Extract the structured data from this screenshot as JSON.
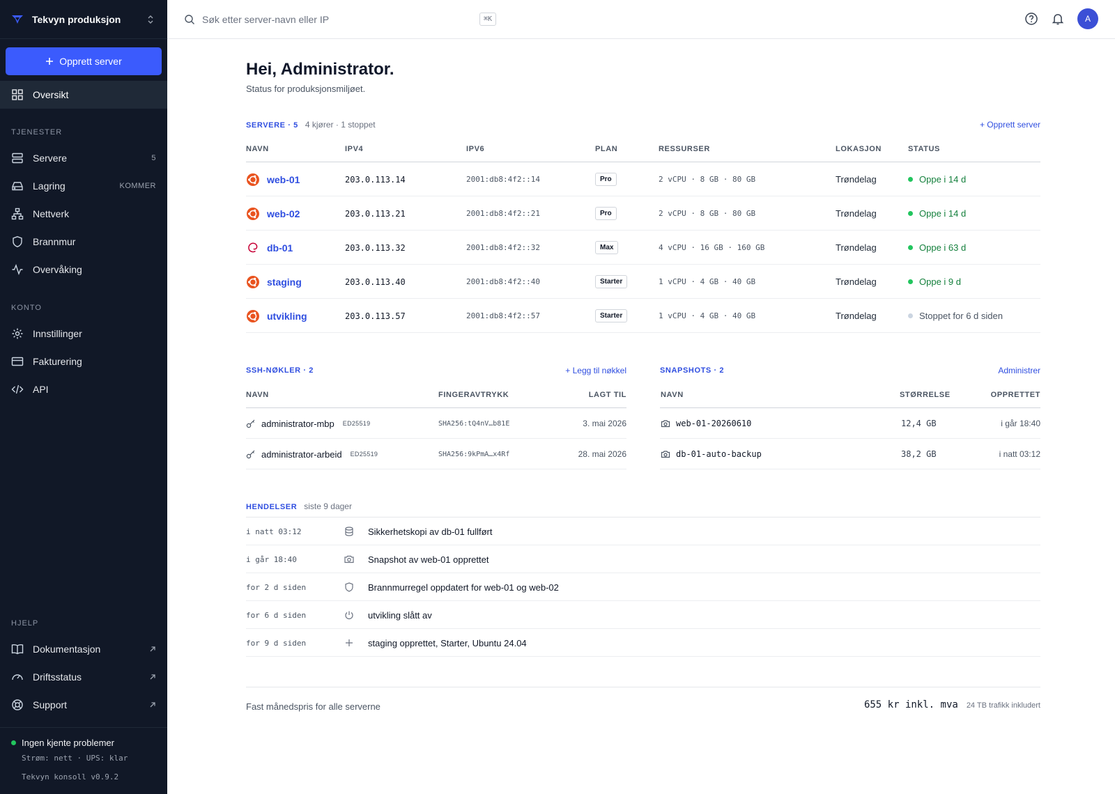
{
  "workspace": {
    "name": "Tekvyn produksjon"
  },
  "sidebar": {
    "create_label": "Opprett server",
    "overview": "Oversikt",
    "sections": {
      "services": "TJENESTER",
      "account": "KONTO",
      "help": "HJELP"
    },
    "services": [
      {
        "label": "Servere",
        "meta": "5",
        "icon": "server-icon"
      },
      {
        "label": "Lagring",
        "meta": "KOMMER",
        "icon": "storage-icon"
      },
      {
        "label": "Nettverk",
        "meta": "",
        "icon": "network-icon"
      },
      {
        "label": "Brannmur",
        "meta": "",
        "icon": "shield-icon"
      },
      {
        "label": "Overvåking",
        "meta": "",
        "icon": "activity-icon"
      }
    ],
    "account": [
      {
        "label": "Innstillinger",
        "icon": "gear-icon"
      },
      {
        "label": "Fakturering",
        "icon": "card-icon"
      },
      {
        "label": "API",
        "icon": "code-icon"
      }
    ],
    "help": [
      {
        "label": "Dokumentasjon",
        "icon": "book-icon"
      },
      {
        "label": "Driftsstatus",
        "icon": "gauge-icon"
      },
      {
        "label": "Support",
        "icon": "lifebuoy-icon"
      }
    ],
    "status": {
      "title": "Ingen kjente problemer",
      "detail": "Strøm: nett · UPS: klar",
      "version": "Tekvyn konsoll v0.9.2"
    }
  },
  "topbar": {
    "search_placeholder": "Søk etter server-navn eller IP",
    "shortcut": "⌘K",
    "avatar": "A"
  },
  "page": {
    "title": "Hei, Administrator.",
    "subtitle": "Status for produksjonsmiljøet."
  },
  "servers": {
    "title": "SERVERE · 5",
    "summary": "4 kjører · 1 stoppet",
    "action": "+ Opprett server",
    "columns": [
      "NAVN",
      "IPV4",
      "IPV6",
      "PLAN",
      "RESSURSER",
      "LOKASJON",
      "STATUS"
    ],
    "rows": [
      {
        "name": "web-01",
        "os": "ubuntu",
        "ipv4": "203.0.113.14",
        "ipv6": "2001:db8:4f2::14",
        "plan": "Pro",
        "resources": "2 vCPU · 8 GB · 80 GB",
        "location": "Trøndelag",
        "status": "Oppe i 14 d",
        "running": true
      },
      {
        "name": "web-02",
        "os": "ubuntu",
        "ipv4": "203.0.113.21",
        "ipv6": "2001:db8:4f2::21",
        "plan": "Pro",
        "resources": "2 vCPU · 8 GB · 80 GB",
        "location": "Trøndelag",
        "status": "Oppe i 14 d",
        "running": true
      },
      {
        "name": "db-01",
        "os": "debian",
        "ipv4": "203.0.113.32",
        "ipv6": "2001:db8:4f2::32",
        "plan": "Max",
        "resources": "4 vCPU · 16 GB · 160 GB",
        "location": "Trøndelag",
        "status": "Oppe i 63 d",
        "running": true
      },
      {
        "name": "staging",
        "os": "ubuntu",
        "ipv4": "203.0.113.40",
        "ipv6": "2001:db8:4f2::40",
        "plan": "Starter",
        "resources": "1 vCPU · 4 GB · 40 GB",
        "location": "Trøndelag",
        "status": "Oppe i 9 d",
        "running": true
      },
      {
        "name": "utvikling",
        "os": "ubuntu",
        "ipv4": "203.0.113.57",
        "ipv6": "2001:db8:4f2::57",
        "plan": "Starter",
        "resources": "1 vCPU · 4 GB · 40 GB",
        "location": "Trøndelag",
        "status": "Stoppet for 6 d siden",
        "running": false
      }
    ]
  },
  "ssh": {
    "title": "SSH-NØKLER · 2",
    "action": "+ Legg til nøkkel",
    "columns": [
      "NAVN",
      "FINGERAVTRYKK",
      "LAGT TIL"
    ],
    "rows": [
      {
        "name": "administrator-mbp",
        "type": "ED25519",
        "fingerprint": "SHA256:tQ4nV…b81E",
        "added": "3. mai 2026"
      },
      {
        "name": "administrator-arbeid",
        "type": "ED25519",
        "fingerprint": "SHA256:9kPmA…x4Rf",
        "added": "28. mai 2026"
      }
    ]
  },
  "snapshots": {
    "title": "SNAPSHOTS · 2",
    "action": "Administrer",
    "columns": [
      "NAVN",
      "STØRRELSE",
      "OPPRETTET"
    ],
    "rows": [
      {
        "name": "web-01-20260610",
        "size": "12,4 GB",
        "created": "i går 18:40"
      },
      {
        "name": "db-01-auto-backup",
        "size": "38,2 GB",
        "created": "i natt 03:12"
      }
    ]
  },
  "events": {
    "title": "HENDELSER",
    "range": "siste 9 dager",
    "rows": [
      {
        "time": "i natt 03:12",
        "icon": "database-icon",
        "text": "Sikkerhetskopi av db-01 fullført"
      },
      {
        "time": "i går 18:40",
        "icon": "camera-icon",
        "text": "Snapshot av web-01 opprettet"
      },
      {
        "time": "for 2 d siden",
        "icon": "shield-icon",
        "text": "Brannmurregel oppdatert for web-01 og web-02"
      },
      {
        "time": "for 6 d siden",
        "icon": "power-icon",
        "text": "utvikling slått av"
      },
      {
        "time": "for 9 d siden",
        "icon": "plus-icon",
        "text": "staging opprettet, Starter, Ubuntu 24.04"
      }
    ]
  },
  "pricing": {
    "label": "Fast månedspris for alle serverne",
    "value": "655 kr inkl. mva",
    "note": "24 TB trafikk inkludert"
  },
  "colors": {
    "accent": "#3b5bfd",
    "link": "#2f4ee0",
    "sidebar": "#111827",
    "ok": "#22c55e",
    "stopped": "#cbd5e1",
    "ubuntu": "#e95420",
    "debian": "#c70036"
  }
}
